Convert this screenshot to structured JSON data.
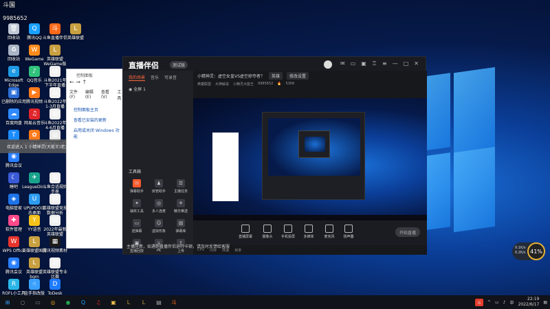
{
  "desktop": {
    "top_left_text": "斗国",
    "top_left_number": "9985652",
    "icons": [
      {
        "label": "回收站",
        "color": "#bfc7d5",
        "icon": "recycle-bin-icon",
        "glyph": "🗑"
      },
      {
        "label": "腾讯QQ",
        "color": "#1aa0ff",
        "icon": "qq-icon",
        "glyph": "Q"
      },
      {
        "label": "斗鱼直播伴侣",
        "color": "#ff6a1a",
        "icon": "douyu-icon",
        "glyph": "斗"
      },
      {
        "label": "英雄联盟",
        "color": "#c8a040",
        "icon": "lol-icon",
        "glyph": "L"
      },
      {
        "label": "回收站",
        "color": "#aab4c4",
        "icon": "bin-icon",
        "glyph": "♻"
      },
      {
        "label": "WeGame",
        "color": "#ff8c1a",
        "icon": "wegame-icon",
        "glyph": "W"
      },
      {
        "label": "英雄联盟WeGame版",
        "color": "#c8a040",
        "icon": "lol-wegame-icon",
        "glyph": "L"
      },
      {
        "label": "Microsoft Edge",
        "color": "#1f9be6",
        "icon": "edge-icon",
        "glyph": "e"
      },
      {
        "label": "QQ音乐",
        "color": "#31c27c",
        "icon": "qqmusic-icon",
        "glyph": "♪"
      },
      {
        "label": "斗鱼2021年下半年直播",
        "color": "#f0f0f0",
        "icon": "doc-icon",
        "glyph": "▤"
      },
      {
        "label": "已删除的应用",
        "color": "#2d6fd6",
        "icon": "folder-icon",
        "glyph": "▣"
      },
      {
        "label": "腾讯视频",
        "color": "#ff7a1a",
        "icon": "tencent-video-icon",
        "glyph": "▶"
      },
      {
        "label": "斗鱼2022年1-3月直播",
        "color": "#f0f0f0",
        "icon": "doc-icon",
        "glyph": "▤"
      },
      {
        "label": "百度网盘",
        "color": "#2f8bff",
        "icon": "baidu-pan-icon",
        "glyph": "☁"
      },
      {
        "label": "网易云音乐",
        "color": "#e0262c",
        "icon": "netease-music-icon",
        "glyph": "♫"
      },
      {
        "label": "斗鱼2022年4-6月直播",
        "color": "#f0f0f0",
        "icon": "doc-icon",
        "glyph": "▤"
      },
      {
        "label": "TT语音",
        "color": "#1b8cff",
        "icon": "tt-voice-icon",
        "glyph": "T"
      },
      {
        "label": "向日葵企业版",
        "color": "#ff7a1a",
        "icon": "sunflower-icon",
        "glyph": "✿"
      },
      {
        "label": "大数据公式",
        "color": "#e8e8e8",
        "icon": "doc-icon",
        "glyph": "▤"
      },
      {
        "label": "腾讯会议",
        "color": "#2a7fff",
        "icon": "meeting-icon",
        "glyph": "◉"
      },
      {
        "label": "睡吧",
        "color": "#3a5ad6",
        "icon": "app-icon",
        "glyph": "☾"
      },
      {
        "label": "LeagueDir...",
        "color": "#19a28c",
        "icon": "league-dir-icon",
        "glyph": "✈"
      },
      {
        "label": "斗鱼合适规则手册",
        "color": "#f0f0f0",
        "icon": "doc-icon",
        "glyph": "▤"
      },
      {
        "label": "电脑管家",
        "color": "#1e73e8",
        "icon": "pc-manager-icon",
        "glyph": "◈"
      },
      {
        "label": "UPUPOO动态桌面",
        "color": "#2d9bf0",
        "icon": "upupoo-icon",
        "glyph": "U"
      },
      {
        "label": "英雄联盟竞技数据分析",
        "color": "#f0f0f0",
        "icon": "doc-icon",
        "glyph": "▤"
      },
      {
        "label": "软件管理",
        "color": "#ff4a8a",
        "icon": "software-mgr-icon",
        "glyph": "✚"
      },
      {
        "label": "YY语音",
        "color": "#f6c21a",
        "icon": "yy-icon",
        "glyph": "Y"
      },
      {
        "label": "2022年最新英雄联盟",
        "color": "#f0f0f0",
        "icon": "doc-icon",
        "glyph": "▤"
      },
      {
        "label": "WPS Office",
        "color": "#e8342c",
        "icon": "wps-icon",
        "glyph": "W"
      },
      {
        "label": "英雄联盟国服",
        "color": "#c8a040",
        "icon": "lol-cn-icon",
        "glyph": "L"
      },
      {
        "label": "腾讯视频素材",
        "color": "#1b1b1b",
        "icon": "video-material-icon",
        "glyph": "▦"
      },
      {
        "label": "腾讯会议",
        "color": "#2a7fff",
        "icon": "tmeeting-icon",
        "glyph": "◉"
      },
      {
        "label": "英雄联盟bgm",
        "color": "#c8a040",
        "icon": "lol-bgm-icon",
        "glyph": "L"
      },
      {
        "label": "英雄联盟专业比赛",
        "color": "#f0f0f0",
        "icon": "doc-icon",
        "glyph": "▤"
      },
      {
        "label": "ROFL小工具",
        "color": "#2bb6e8",
        "icon": "rofl-icon",
        "glyph": "R"
      },
      {
        "label": "金手指改版",
        "color": "#3aa0ff",
        "icon": "gold-finger-icon",
        "glyph": "☝"
      },
      {
        "label": "ToDesk",
        "color": "#1e7bff",
        "icon": "todesk-icon",
        "glyph": "D"
      }
    ]
  },
  "explorer": {
    "title": "控制面板",
    "menu": [
      "文件(F)",
      "编辑(E)",
      "查看(V)",
      "工具"
    ],
    "links": [
      "控制面板主页",
      "查看已安装的更新",
      "启用或关闭 Windows 功能"
    ]
  },
  "tooltip": {
    "text": "欢迎进入 1 小精神灵(大能王)老大直播间"
  },
  "app": {
    "title": "直播伴侣",
    "version": "测试版",
    "tabs": [
      "我的场景",
      "音乐",
      "可录音"
    ],
    "scene": "全屏 1",
    "toolbox_title": "工具箱",
    "tools": [
      {
        "label": "弹幕助手",
        "icon": "danmaku-icon",
        "glyph": "✉",
        "highlight": true
      },
      {
        "label": "房管助手",
        "icon": "manager-icon",
        "glyph": "♟",
        "highlight": false
      },
      {
        "label": "主播任务",
        "icon": "task-icon",
        "glyph": "☰",
        "highlight": false
      },
      {
        "label": "抽奖工具",
        "icon": "lottery-icon",
        "glyph": "✦",
        "highlight": false
      },
      {
        "label": "多人连麦",
        "icon": "multi-mic-icon",
        "glyph": "◎",
        "highlight": false
      },
      {
        "label": "精华推送",
        "icon": "push-icon",
        "glyph": "✈",
        "highlight": false
      },
      {
        "label": "送弹幕",
        "icon": "send-danmaku-icon",
        "glyph": "▭",
        "highlight": false
      },
      {
        "label": "虚拟形象",
        "icon": "avatar-tool-icon",
        "glyph": "☺",
        "highlight": false
      },
      {
        "label": "弹幕库",
        "icon": "library-icon",
        "glyph": "▤",
        "highlight": false
      },
      {
        "label": "直播回放",
        "icon": "replay-icon",
        "glyph": "▣",
        "highlight": false
      },
      {
        "label": "PK",
        "icon": "pk-icon",
        "glyph": "⚔",
        "highlight": false
      },
      {
        "label": "上传",
        "icon": "upload-icon",
        "glyph": "⇧",
        "highlight": false
      }
    ],
    "stream_title": "小精神灵：虚空女皇VS虚空掠夺者？",
    "category_chip": "英雄",
    "edit_chip": "修改设置",
    "room_chip": "英雄联盟",
    "sub_info": [
      "大神解说",
      "小精灵大能王",
      "9985652",
      "5306"
    ],
    "controls": [
      {
        "label": "直播屏幕",
        "icon": "screen-icon"
      },
      {
        "label": "摄像头",
        "icon": "camera-icon"
      },
      {
        "label": "手机投屏",
        "icon": "phone-cast-icon"
      },
      {
        "label": "多媒体",
        "icon": "media-icon"
      },
      {
        "label": "麦克风",
        "icon": "mic-icon"
      },
      {
        "label": "扬声器",
        "icon": "speaker-icon"
      }
    ],
    "live_button": "开始直播",
    "status": [
      "CPU",
      "内存",
      "网速",
      "帧率"
    ],
    "notice": "主播注意，如遇到直播伴侣运行卡顿，请及时反馈给客服"
  },
  "speed_ball": {
    "value": "41%",
    "up": "0.1K/s",
    "down": "0.2K/s"
  },
  "taskbar": {
    "apps": [
      {
        "icon": "windows-start-icon",
        "glyph": "⊞",
        "color": "#3aa0ff"
      },
      {
        "icon": "search-icon",
        "glyph": "○",
        "color": "#888"
      },
      {
        "icon": "taskview-icon",
        "glyph": "▭",
        "color": "#888"
      },
      {
        "icon": "chrome-icon",
        "glyph": "◎",
        "color": "#e8a020"
      },
      {
        "icon": "wechat-icon",
        "glyph": "◉",
        "color": "#2ac15a"
      },
      {
        "icon": "qq-task-icon",
        "glyph": "Q",
        "color": "#1aa0ff"
      },
      {
        "icon": "netease-task-icon",
        "glyph": "♫",
        "color": "#e0262c"
      },
      {
        "icon": "folder-task-icon",
        "glyph": "▣",
        "color": "#f2c14e"
      },
      {
        "icon": "lol-task-icon",
        "glyph": "L",
        "color": "#c8a040"
      },
      {
        "icon": "lol2-task-icon",
        "glyph": "L",
        "color": "#c8a040"
      },
      {
        "icon": "explorer-task-icon",
        "glyph": "▤",
        "color": "#aaa"
      },
      {
        "icon": "douyu-task-icon",
        "glyph": "斗",
        "color": "#ff6a1a"
      }
    ],
    "time": "22:19",
    "date": "2022/6/17"
  }
}
